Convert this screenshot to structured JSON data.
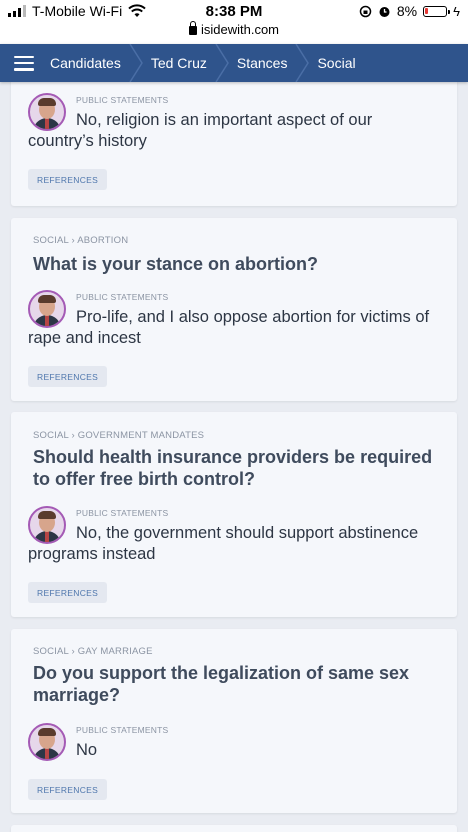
{
  "status_bar": {
    "carrier": "T-Mobile Wi-Fi",
    "time": "8:38 PM",
    "url": "isidewith.com",
    "battery": "8%"
  },
  "nav": {
    "crumbs": [
      "Candidates",
      "Ted Cruz",
      "Stances",
      "Social"
    ]
  },
  "cards": [
    {
      "category": "",
      "question": "",
      "source_label": "PUBLIC STATEMENTS",
      "answer": "No, religion is an important aspect of our country’s history",
      "references_label": "REFERENCES"
    },
    {
      "category": "SOCIAL › ABORTION",
      "question": "What is your stance on abortion?",
      "source_label": "PUBLIC STATEMENTS",
      "answer": "Pro-life, and I also oppose abortion for victims of rape and incest",
      "references_label": "REFERENCES"
    },
    {
      "category": "SOCIAL › GOVERNMENT MANDATES",
      "question": "Should health insurance providers be required to offer free birth control?",
      "source_label": "PUBLIC STATEMENTS",
      "answer": "No, the government should support abstinence programs instead",
      "references_label": "REFERENCES"
    },
    {
      "category": "SOCIAL › GAY MARRIAGE",
      "question": "Do you support the legalization of same sex marriage?",
      "source_label": "PUBLIC STATEMENTS",
      "answer": "No",
      "references_label": "REFERENCES"
    }
  ],
  "colors": {
    "nav_bg": "#2f548c",
    "page_bg": "#e9ecf2",
    "card_bg": "#f5f7fb",
    "avatar_ring": "#a45ab5",
    "references_text": "#4f77ad"
  }
}
